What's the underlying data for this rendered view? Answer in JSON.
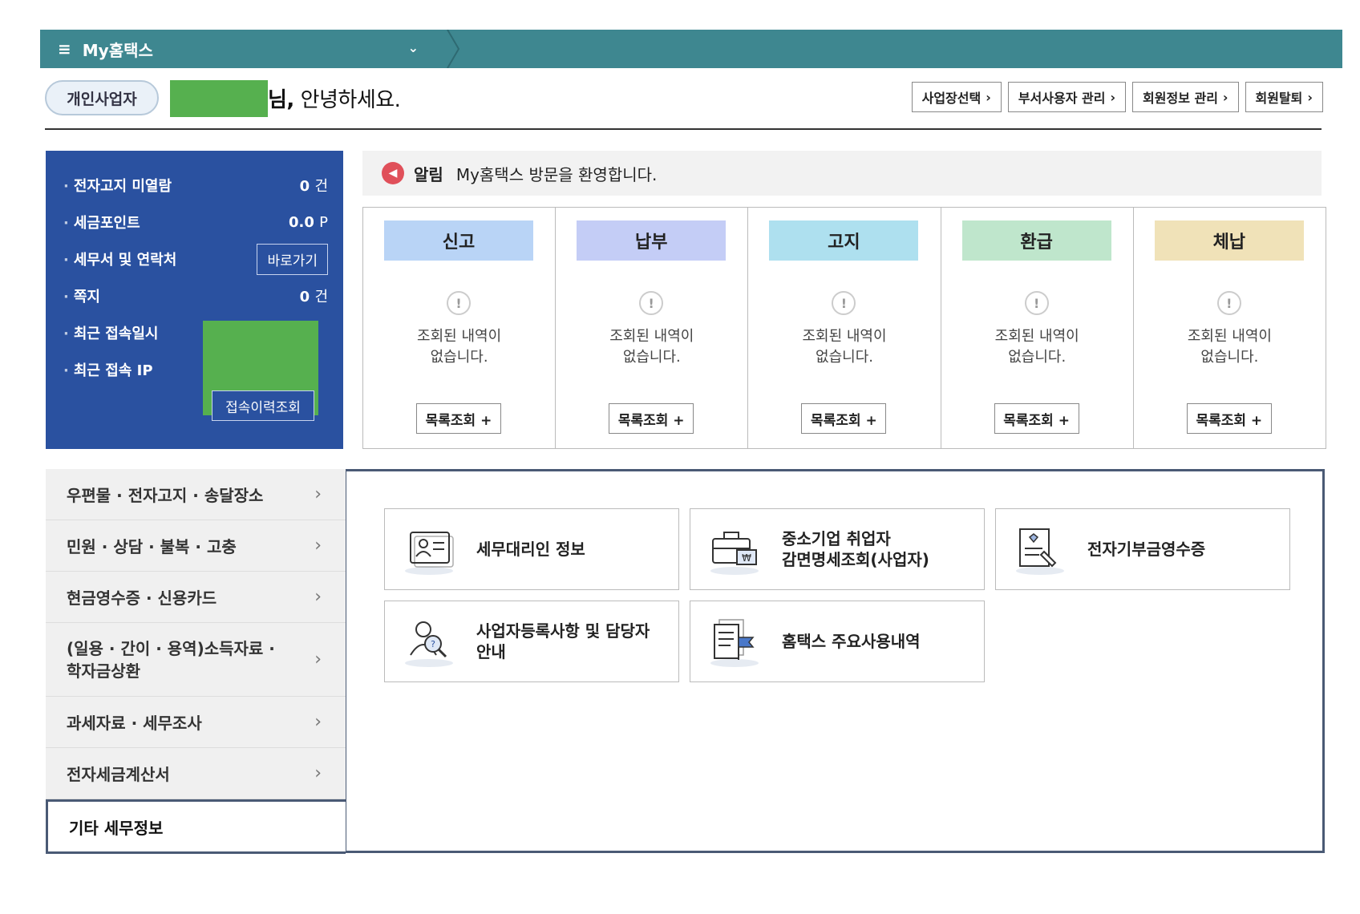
{
  "topbar": {
    "menu_label": "My홈택스"
  },
  "header": {
    "badge": "개인사업자",
    "greeting_suffix": "님,",
    "greeting_text": " 안녕하세요.",
    "links": [
      "사업장선택",
      "부서사용자 관리",
      "회원정보 관리",
      "회원탈퇴"
    ]
  },
  "info_panel": {
    "rows": [
      {
        "label": "전자고지 미열람",
        "value": "0",
        "unit": "건"
      },
      {
        "label": "세금포인트",
        "value": "0.0",
        "unit": "P"
      },
      {
        "label": "세무서 및 연락처",
        "button": "바로가기"
      },
      {
        "label": "쪽지",
        "value": "0",
        "unit": "건"
      },
      {
        "label": "최근 접속일시"
      },
      {
        "label": "최근 접속 IP"
      }
    ],
    "history_button": "접속이력조회"
  },
  "notice": {
    "tag": "알림",
    "message": "My홈택스 방문을 환영합니다."
  },
  "status_cards": [
    {
      "label": "신고",
      "color": "#b9d4f6",
      "empty": "조회된 내역이\n없습니다.",
      "button": "목록조회 +"
    },
    {
      "label": "납부",
      "color": "#c4cdf6",
      "empty": "조회된 내역이\n없습니다.",
      "button": "목록조회 +"
    },
    {
      "label": "고지",
      "color": "#aee0ef",
      "empty": "조회된 내역이\n없습니다.",
      "button": "목록조회 +"
    },
    {
      "label": "환급",
      "color": "#bfe6cc",
      "empty": "조회된 내역이\n없습니다.",
      "button": "목록조회 +"
    },
    {
      "label": "체납",
      "color": "#f0e2b8",
      "empty": "조회된 내역이\n없습니다.",
      "button": "목록조회 +"
    }
  ],
  "side_menu": [
    "우편물 · 전자고지 · 송달장소",
    "민원 · 상담 · 불복 · 고충",
    "현금영수증 · 신용카드",
    "(일용 · 간이 · 용역)소득자료 ·\n학자금상환",
    "과세자료 · 세무조사",
    "전자세금계산서",
    "기타 세무정보"
  ],
  "tiles": [
    {
      "label": "세무대리인 정보",
      "icon": "id-card-icon"
    },
    {
      "label": "중소기업 취업자\n감면명세조회(사업자)",
      "icon": "briefcase-won-icon"
    },
    {
      "label": "전자기부금영수증",
      "icon": "donation-receipt-icon"
    },
    {
      "label": "사업자등록사항 및 담당자\n안내",
      "icon": "person-search-icon"
    },
    {
      "label": "홈택스 주요사용내역",
      "icon": "document-flag-icon"
    }
  ]
}
